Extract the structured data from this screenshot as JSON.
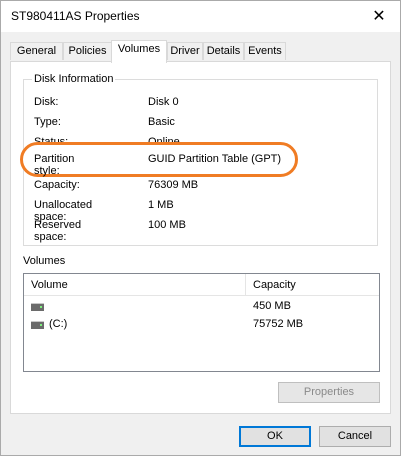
{
  "window": {
    "title": "ST980411AS Properties",
    "close_glyph": "✕"
  },
  "tabs": [
    {
      "label": "General",
      "active": false
    },
    {
      "label": "Policies",
      "active": false
    },
    {
      "label": "Volumes",
      "active": true
    },
    {
      "label": "Driver",
      "active": false
    },
    {
      "label": "Details",
      "active": false
    },
    {
      "label": "Events",
      "active": false
    }
  ],
  "disk_info": {
    "legend": "Disk Information",
    "rows": [
      {
        "label": "Disk:",
        "value": "Disk 0"
      },
      {
        "label": "Type:",
        "value": "Basic"
      },
      {
        "label": "Status:",
        "value": "Online"
      },
      {
        "label": "Partition style:",
        "value": "GUID Partition Table (GPT)"
      },
      {
        "label": "Capacity:",
        "value": "76309 MB"
      },
      {
        "label": "Unallocated space:",
        "value": "1 MB"
      },
      {
        "label": "Reserved space:",
        "value": "100 MB"
      }
    ],
    "highlight_color": "#f07c24"
  },
  "volumes": {
    "label": "Volumes",
    "columns": {
      "volume": "Volume",
      "capacity": "Capacity"
    },
    "rows": [
      {
        "name": "",
        "capacity": "450 MB",
        "icon": "drive-icon"
      },
      {
        "name": "(C:)",
        "capacity": "75752 MB",
        "icon": "drive-icon"
      }
    ],
    "properties_button": "Properties"
  },
  "footer": {
    "ok": "OK",
    "cancel": "Cancel"
  }
}
